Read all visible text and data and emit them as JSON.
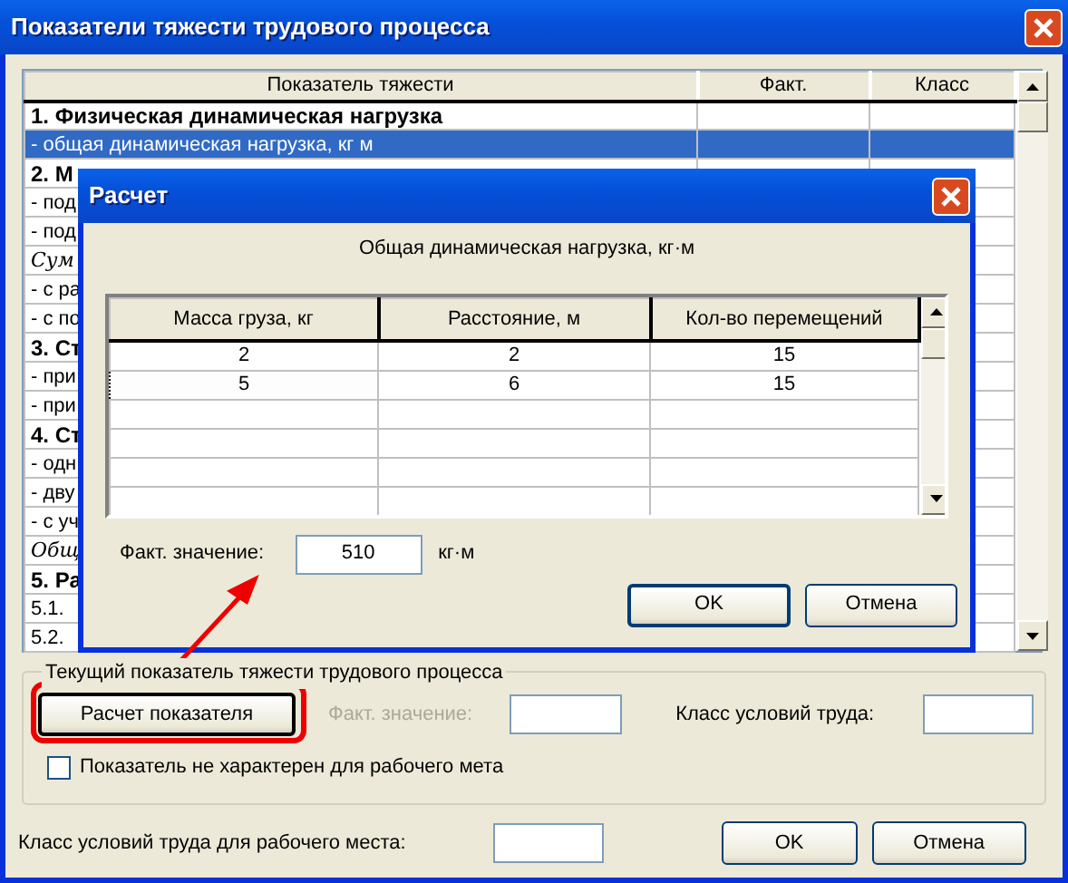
{
  "window": {
    "title": "Показатели тяжести трудового процесса"
  },
  "grid": {
    "columns": [
      "Показатель тяжести",
      "Факт.",
      "Класс"
    ],
    "rows": [
      {
        "name": "1. Физическая динамическая нагрузка",
        "kind": "section",
        "selected": false
      },
      {
        "name": "- общая динамическая нагрузка, кг м",
        "kind": "item",
        "selected": true
      },
      {
        "name": "2. М",
        "kind": "section",
        "selected": false
      },
      {
        "name": "- под",
        "kind": "item",
        "selected": false
      },
      {
        "name": "- под",
        "kind": "item",
        "selected": false
      },
      {
        "name": "Сум",
        "kind": "sum",
        "selected": false
      },
      {
        "name": "- с ра",
        "kind": "item",
        "selected": false
      },
      {
        "name": "- с по",
        "kind": "item",
        "selected": false
      },
      {
        "name": "3. Ст",
        "kind": "section",
        "selected": false
      },
      {
        "name": "- при",
        "kind": "item",
        "selected": false
      },
      {
        "name": "- при",
        "kind": "item",
        "selected": false
      },
      {
        "name": "4. Ст",
        "kind": "section",
        "selected": false
      },
      {
        "name": "- одн",
        "kind": "item",
        "selected": false
      },
      {
        "name": "- дву",
        "kind": "item",
        "selected": false
      },
      {
        "name": "- с уч",
        "kind": "item",
        "selected": false
      },
      {
        "name": "Общ",
        "kind": "sum",
        "selected": false
      },
      {
        "name": "5. Ра",
        "kind": "section",
        "selected": false
      },
      {
        "name": "5.1.",
        "kind": "item",
        "selected": false
      },
      {
        "name": "5.2.",
        "kind": "item",
        "selected": false
      }
    ]
  },
  "dialog": {
    "title": "Расчет",
    "caption": "Общая динамическая нагрузка, кг·м",
    "table": {
      "columns": [
        "Масса груза, кг",
        "Расстояние, м",
        "Кол-во перемещений"
      ],
      "rows": [
        {
          "cells": [
            "2",
            "2",
            "15"
          ],
          "focused": false
        },
        {
          "cells": [
            "5",
            "6",
            "15"
          ],
          "focused": true
        }
      ]
    },
    "fact_label": "Факт. значение:",
    "fact_value": "510",
    "unit": "кг·м",
    "buttons": [
      "OK",
      "Отмена"
    ]
  },
  "current": {
    "legend": "Текущий показатель тяжести трудового процесса",
    "calc_button": "Расчет показателя",
    "fact_label": "Факт. значение:",
    "fact_disabled": true,
    "class_label": "Класс условий труда:",
    "checkbox": {
      "label": "Показатель не характерен для рабочего мета",
      "checked": false
    }
  },
  "footer": {
    "label": "Класс условий труда для рабочего места:",
    "buttons": [
      "OK",
      "Отмена"
    ]
  }
}
